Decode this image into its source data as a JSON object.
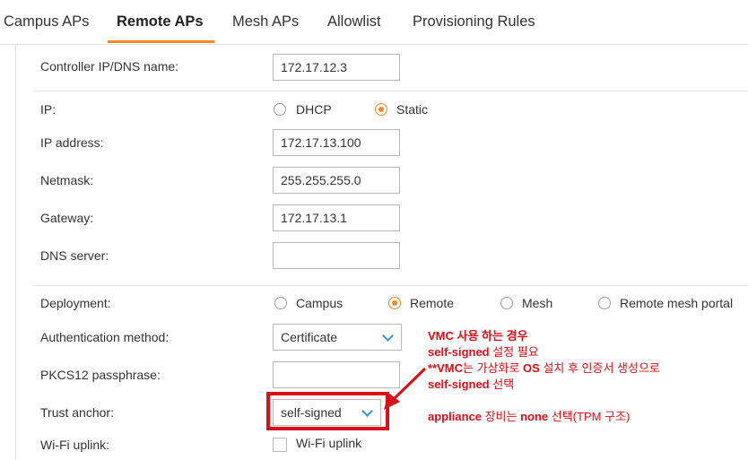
{
  "tabs": [
    {
      "label": "Campus APs"
    },
    {
      "label": "Remote APs"
    },
    {
      "label": "Mesh APs"
    },
    {
      "label": "Allowlist"
    },
    {
      "label": "Provisioning Rules"
    }
  ],
  "active_tab": "Remote APs",
  "colors": {
    "accent": "#ef8a2a",
    "annotation": "#d9101a",
    "dropdown_chevron": "#3a8fd6"
  },
  "form": {
    "controller": {
      "label": "Controller IP/DNS name:",
      "value": "172.17.12.3"
    },
    "ip": {
      "label": "IP:",
      "options": [
        "DHCP",
        "Static"
      ],
      "selected": "Static"
    },
    "ip_address": {
      "label": "IP address:",
      "value": "172.17.13.100"
    },
    "netmask": {
      "label": "Netmask:",
      "value": "255.255.255.0"
    },
    "gateway": {
      "label": "Gateway:",
      "value": "172.17.13.1"
    },
    "dns": {
      "label": "DNS server:",
      "value": ""
    },
    "deployment": {
      "label": "Deployment:",
      "options": [
        "Campus",
        "Remote",
        "Mesh",
        "Remote mesh portal"
      ],
      "selected": "Remote"
    },
    "auth_method": {
      "label": "Authentication method:",
      "value": "Certificate"
    },
    "pkcs12": {
      "label": "PKCS12 passphrase:",
      "value": ""
    },
    "trust_anchor": {
      "label": "Trust anchor:",
      "value": "self-signed"
    },
    "wifi_uplink": {
      "label": "Wi-Fi uplink:",
      "checkbox_label": "Wi-Fi uplink",
      "checked": false
    }
  },
  "annotation": {
    "line1": "VMC 사용 하는 경우",
    "line2_bold": "self-signed",
    "line2_rest": " 설정 필요",
    "line3_bold1": "**VMC",
    "line3_mid": "는 가상화로 ",
    "line3_bold2": "OS",
    "line3_rest": " 설치 후 인증서 생성으로",
    "line4_bold": "self-signed",
    "line4_rest": " 선택",
    "line5_bold1": "appliance",
    "line5_mid": " 장비는 ",
    "line5_bold2": "none",
    "line5_rest": " 선택(TPM 구조)"
  }
}
